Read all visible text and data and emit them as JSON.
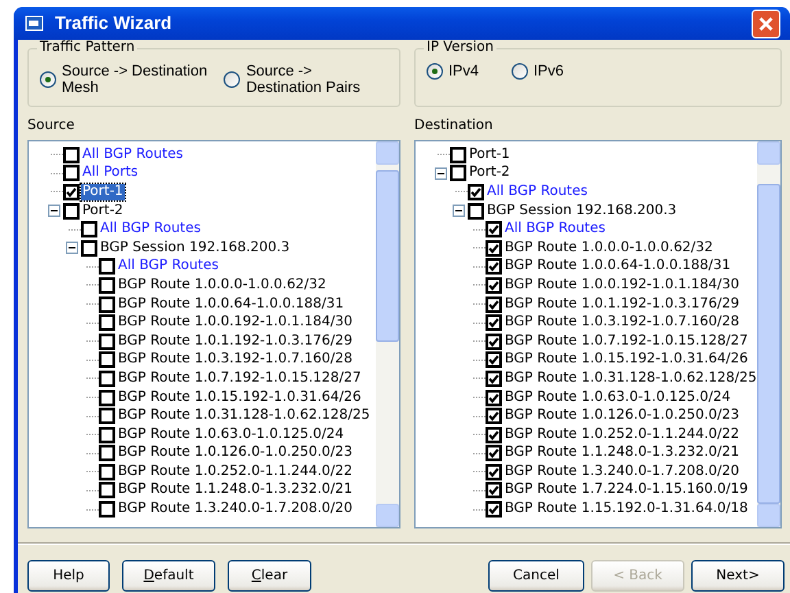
{
  "window": {
    "title": "Traffic Wizard"
  },
  "traffic_pattern": {
    "title": "Traffic Pattern",
    "options": [
      {
        "label": "Source -> Destination Mesh",
        "selected": true
      },
      {
        "label": "Source -> Destination Pairs",
        "selected": false
      }
    ]
  },
  "ip_version": {
    "title": "IP Version",
    "options": [
      {
        "label": "IPv4",
        "selected": true
      },
      {
        "label": "IPv6",
        "selected": false
      }
    ]
  },
  "source": {
    "label": "Source",
    "items": [
      {
        "label": "All BGP Routes",
        "kind": "shortcut",
        "checked": false,
        "selected": false
      },
      {
        "label": "All Ports",
        "kind": "shortcut",
        "checked": false,
        "selected": false
      },
      {
        "label": "Port-1",
        "kind": "node",
        "checked": true,
        "selected": true
      },
      {
        "label": "Port-2",
        "kind": "node",
        "checked": false,
        "selected": false,
        "expanded": true,
        "children": [
          {
            "label": "All BGP Routes",
            "kind": "shortcut",
            "checked": false,
            "selected": false
          },
          {
            "label": "BGP Session 192.168.200.3",
            "kind": "node",
            "checked": false,
            "selected": false,
            "expanded": true,
            "children": [
              {
                "label": "All BGP Routes",
                "kind": "shortcut",
                "checked": false,
                "selected": false
              },
              {
                "label": "BGP Route 1.0.0.0-1.0.0.62/32",
                "kind": "node",
                "checked": false,
                "selected": false
              },
              {
                "label": "BGP Route 1.0.0.64-1.0.0.188/31",
                "kind": "node",
                "checked": false,
                "selected": false
              },
              {
                "label": "BGP Route 1.0.0.192-1.0.1.184/30",
                "kind": "node",
                "checked": false,
                "selected": false
              },
              {
                "label": "BGP Route 1.0.1.192-1.0.3.176/29",
                "kind": "node",
                "checked": false,
                "selected": false
              },
              {
                "label": "BGP Route 1.0.3.192-1.0.7.160/28",
                "kind": "node",
                "checked": false,
                "selected": false
              },
              {
                "label": "BGP Route 1.0.7.192-1.0.15.128/27",
                "kind": "node",
                "checked": false,
                "selected": false
              },
              {
                "label": "BGP Route 1.0.15.192-1.0.31.64/26",
                "kind": "node",
                "checked": false,
                "selected": false
              },
              {
                "label": "BGP Route 1.0.31.128-1.0.62.128/25",
                "kind": "node",
                "checked": false,
                "selected": false
              },
              {
                "label": "BGP Route 1.0.63.0-1.0.125.0/24",
                "kind": "node",
                "checked": false,
                "selected": false
              },
              {
                "label": "BGP Route 1.0.126.0-1.0.250.0/23",
                "kind": "node",
                "checked": false,
                "selected": false
              },
              {
                "label": "BGP Route 1.0.252.0-1.1.244.0/22",
                "kind": "node",
                "checked": false,
                "selected": false
              },
              {
                "label": "BGP Route 1.1.248.0-1.3.232.0/21",
                "kind": "node",
                "checked": false,
                "selected": false
              },
              {
                "label": "BGP Route 1.3.240.0-1.7.208.0/20",
                "kind": "node",
                "checked": false,
                "selected": false
              }
            ]
          }
        ]
      }
    ]
  },
  "destination": {
    "label": "Destination",
    "items": [
      {
        "label": "Port-1",
        "kind": "node",
        "checked": false,
        "selected": false
      },
      {
        "label": "Port-2",
        "kind": "node",
        "checked": false,
        "selected": false,
        "expanded": true,
        "children": [
          {
            "label": "All BGP Routes",
            "kind": "shortcut",
            "checked": true,
            "selected": false
          },
          {
            "label": "BGP Session 192.168.200.3",
            "kind": "node",
            "checked": false,
            "selected": false,
            "expanded": true,
            "children": [
              {
                "label": "All BGP Routes",
                "kind": "shortcut",
                "checked": true,
                "selected": false
              },
              {
                "label": "BGP Route 1.0.0.0-1.0.0.62/32",
                "kind": "node",
                "checked": true,
                "selected": false
              },
              {
                "label": "BGP Route 1.0.0.64-1.0.0.188/31",
                "kind": "node",
                "checked": true,
                "selected": false
              },
              {
                "label": "BGP Route 1.0.0.192-1.0.1.184/30",
                "kind": "node",
                "checked": true,
                "selected": false
              },
              {
                "label": "BGP Route 1.0.1.192-1.0.3.176/29",
                "kind": "node",
                "checked": true,
                "selected": false
              },
              {
                "label": "BGP Route 1.0.3.192-1.0.7.160/28",
                "kind": "node",
                "checked": true,
                "selected": false
              },
              {
                "label": "BGP Route 1.0.7.192-1.0.15.128/27",
                "kind": "node",
                "checked": true,
                "selected": false
              },
              {
                "label": "BGP Route 1.0.15.192-1.0.31.64/26",
                "kind": "node",
                "checked": true,
                "selected": false
              },
              {
                "label": "BGP Route 1.0.31.128-1.0.62.128/25",
                "kind": "node",
                "checked": true,
                "selected": false
              },
              {
                "label": "BGP Route 1.0.63.0-1.0.125.0/24",
                "kind": "node",
                "checked": true,
                "selected": false
              },
              {
                "label": "BGP Route 1.0.126.0-1.0.250.0/23",
                "kind": "node",
                "checked": true,
                "selected": false
              },
              {
                "label": "BGP Route 1.0.252.0-1.1.244.0/22",
                "kind": "node",
                "checked": true,
                "selected": false
              },
              {
                "label": "BGP Route 1.1.248.0-1.3.232.0/21",
                "kind": "node",
                "checked": true,
                "selected": false
              },
              {
                "label": "BGP Route 1.3.240.0-1.7.208.0/20",
                "kind": "node",
                "checked": true,
                "selected": false
              },
              {
                "label": "BGP Route 1.7.224.0-1.15.160.0/19",
                "kind": "node",
                "checked": true,
                "selected": false
              },
              {
                "label": "BGP Route 1.15.192.0-1.31.64.0/18",
                "kind": "node",
                "checked": true,
                "selected": false
              }
            ]
          }
        ]
      }
    ]
  },
  "buttons_left": [
    {
      "label": "Help",
      "mnemonic": false,
      "disabled": false
    },
    {
      "label": "Default",
      "mnemonic": true,
      "disabled": false
    },
    {
      "label": "Clear",
      "mnemonic": true,
      "disabled": false
    }
  ],
  "buttons_right": [
    {
      "label": "Cancel",
      "mnemonic": false,
      "disabled": false
    },
    {
      "label": "< Back",
      "mnemonic": false,
      "disabled": true
    },
    {
      "label": "Next>",
      "mnemonic": false,
      "disabled": false
    }
  ]
}
